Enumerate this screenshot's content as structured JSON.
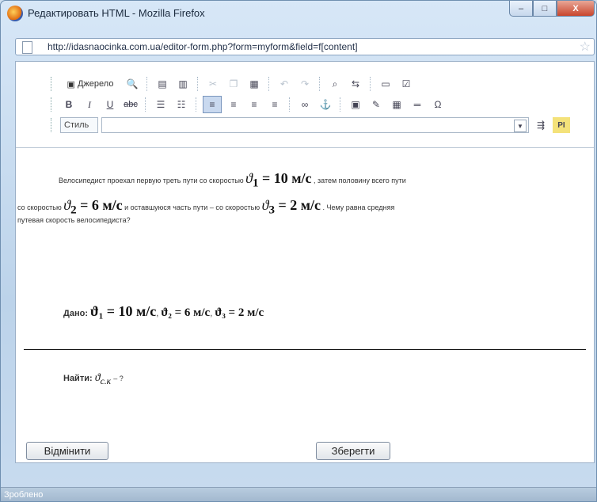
{
  "window": {
    "title": "Редактировать HTML - Mozilla Firefox",
    "buttons": {
      "minimize": "–",
      "maximize": "□",
      "close": "X"
    }
  },
  "urlbar": {
    "url": "http://idasnaocinka.com.ua/editor-form.php?form=myform&field=f[content]"
  },
  "toolbar": {
    "row1": {
      "source": "Джерело"
    },
    "row2": {
      "bold": "B",
      "italic": "I",
      "underline": "U",
      "strike": "abc",
      "omega": "Ω"
    },
    "row3": {
      "style_label": "Стиль",
      "style_value": ""
    }
  },
  "editor": {
    "p1_start": "Велосипедист проехал первую треть пути со скоростью",
    "p1_end": ", затем половину всего пути",
    "p2_start": "со скоростью",
    "p2_mid": "и оставшуюся часть пути – со скоростью",
    "p2_end": ". Чему равна средняя",
    "p3": "путевая скорость велосипедиста?",
    "v1_sym": "ϑ",
    "v1_sub": "1",
    "v1_val": "= 10 м/с",
    "v2_sym": "ϑ",
    "v2_sub": "2",
    "v2_val": "= 6 м/с",
    "v3_sym": "ϑ",
    "v3_sub": "3",
    "v3_val": "= 2 м/с",
    "given_label": "Дано:",
    "given_v1": "ϑ₁ = 10 м/с",
    "given_v2": "ϑ₂ = 6 м/с",
    "given_v3": "ϑ₃ = 2 м/с",
    "find_label": "Найти:",
    "find_expr": "ϑ",
    "find_sub": "с.к",
    "find_tail": "– ?"
  },
  "buttons": {
    "cancel": "Відмінити",
    "save": "Зберегти"
  },
  "status": {
    "text": "Зроблено"
  }
}
